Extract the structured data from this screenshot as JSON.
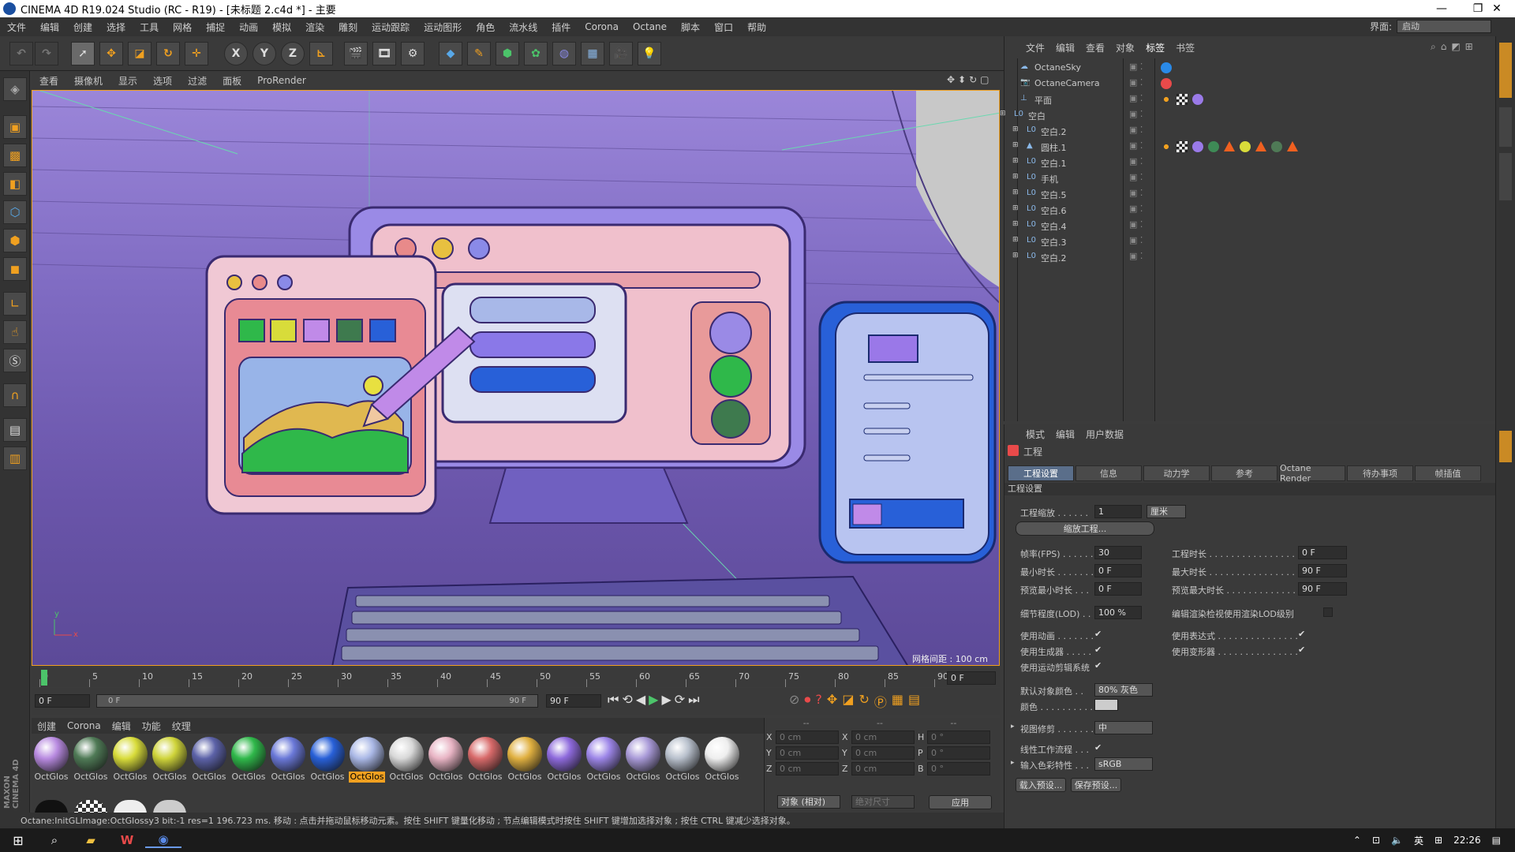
{
  "window": {
    "title": "CINEMA 4D R19.024 Studio (RC - R19) - [未标题 2.c4d *] - 主要"
  },
  "menu": [
    "文件",
    "编辑",
    "创建",
    "选择",
    "工具",
    "网格",
    "捕捉",
    "动画",
    "模拟",
    "渲染",
    "雕刻",
    "运动跟踪",
    "运动图形",
    "角色",
    "流水线",
    "插件",
    "Corona",
    "Octane",
    "脚本",
    "窗口",
    "帮助"
  ],
  "layout": {
    "label": "界面:",
    "value": "启动"
  },
  "viewport_menu": [
    "查看",
    "摄像机",
    "显示",
    "选项",
    "过滤",
    "面板",
    "ProRender"
  ],
  "viewport": {
    "grid_spacing": "网格间距 : 100 cm"
  },
  "timeline": {
    "ticks": [
      "0",
      "5",
      "10",
      "15",
      "20",
      "25",
      "30",
      "35",
      "40",
      "45",
      "50",
      "55",
      "60",
      "65",
      "70",
      "75",
      "80",
      "85",
      "90"
    ],
    "current_frame": "0 F",
    "start": "0 F",
    "range_start": "0 F",
    "range_end": "90 F",
    "end": "90 F"
  },
  "material_menu": [
    "创建",
    "Corona",
    "编辑",
    "功能",
    "纹理"
  ],
  "materials": [
    {
      "name": "OctGlos",
      "color": "#b88ae0"
    },
    {
      "name": "OctGlos",
      "color": "#4f7a56"
    },
    {
      "name": "OctGlos",
      "color": "#d8dc3a"
    },
    {
      "name": "OctGlos",
      "color": "#cfd43a"
    },
    {
      "name": "OctGlos",
      "color": "#5c62a8"
    },
    {
      "name": "OctGlos",
      "color": "#2fb84a"
    },
    {
      "name": "OctGlos",
      "color": "#6a78d8"
    },
    {
      "name": "OctGlos",
      "color": "#2860d8"
    },
    {
      "name": "OctGlos",
      "color": "#aab8e6",
      "selected": true
    },
    {
      "name": "OctGlos",
      "color": "#d8d8d8"
    },
    {
      "name": "OctGlos",
      "color": "#e8b4c4"
    },
    {
      "name": "OctGlos",
      "color": "#d86a6a"
    },
    {
      "name": "OctGlos",
      "color": "#e0b040"
    },
    {
      "name": "OctGlos",
      "color": "#8e6adc"
    },
    {
      "name": "OctGlos",
      "color": "#9d86e8"
    },
    {
      "name": "OctGlos",
      "color": "#a99ad8"
    },
    {
      "name": "OctGlos",
      "color": "#b8c0cc"
    },
    {
      "name": "OctGlos",
      "color": "#eeeeee"
    }
  ],
  "coords": {
    "header": [
      "--",
      "--",
      "--"
    ],
    "rows": [
      {
        "a": "X",
        "v1": "0 cm",
        "b": "X",
        "v2": "0 cm",
        "c": "H",
        "v3": "0 °"
      },
      {
        "a": "Y",
        "v1": "0 cm",
        "b": "Y",
        "v2": "0 cm",
        "c": "P",
        "v3": "0 °"
      },
      {
        "a": "Z",
        "v1": "0 cm",
        "b": "Z",
        "v2": "0 cm",
        "c": "B",
        "v3": "0 °"
      }
    ],
    "mode": "对象 (相对)",
    "size": "绝对尺寸",
    "apply": "应用"
  },
  "status": "Octane:InitGLImage:OctGlossy3  bit:-1 res=1  196.723 ms.      移动 : 点击并拖动鼠标移动元素。按住 SHIFT 键量化移动 ; 节点编辑模式时按住 SHIFT 键增加选择对象 ; 按住 CTRL 键减少选择对象。",
  "objmgr": {
    "menu": [
      "文件",
      "编辑",
      "查看",
      "对象",
      "标签",
      "书签"
    ],
    "objects": [
      "OctaneSky",
      "OctaneCamera",
      "平面",
      "空白",
      "空白.2",
      "圆柱.1",
      "空白.1",
      "手机",
      "空白.5",
      "空白.6",
      "空白.4",
      "空白.3",
      "空白.2"
    ]
  },
  "attr": {
    "menu": [
      "模式",
      "编辑",
      "用户数据"
    ],
    "title": "工程",
    "tabs": [
      "工程设置",
      "信息",
      "动力学",
      "参考",
      "Octane Render",
      "待办事项",
      "帧插值"
    ],
    "section": "工程设置",
    "scale_label": "工程缩放 . . . . . .",
    "scale_value": "1",
    "scale_unit": "厘米",
    "scale_btn": "缩放工程...",
    "fps_label": "帧率(FPS) . . . . . .",
    "fps": "30",
    "time_label": "工程时长 . . . . . . . . . . . . . . . .",
    "time": "0 F",
    "min_label": "最小时长 . . . . . . .",
    "min": "0 F",
    "max_label": "最大时长 . . . . . . . . . . . . . . . .",
    "max": "90 F",
    "pmin_label": "预览最小时长 . . .",
    "pmin": "0 F",
    "pmax_label": "预览最大时长 . . . . . . . . . . . . .",
    "pmax": "90 F",
    "lod_label": "细节程度(LOD) . . .",
    "lod": "100 %",
    "lod_render_label": "编辑渲染检视使用渲染LOD级别",
    "anim_label": "使用动画 . . . . . . .",
    "expr_label": "使用表达式 . . . . . . . . . . . . . . .",
    "gen_label": "使用生成器 . . . . .",
    "deform_label": "使用变形器 . . . . . . . . . . . . . . .",
    "motion_label": "使用运动剪辑系统",
    "defcolor_label": "默认对象颜色 . .",
    "defcolor": "80% 灰色",
    "color_label": "颜色 . . . . . . . . . .",
    "clip_label": "视图修剪 . . . . . . .",
    "clip": "中",
    "linear_label": "线性工作流程 . . .",
    "input_label": "输入色彩特性 . . .",
    "input": "sRGB",
    "load_btn": "载入预设...",
    "save_btn": "保存预设..."
  },
  "taskbar": {
    "ime": "英",
    "time": "22:26"
  }
}
